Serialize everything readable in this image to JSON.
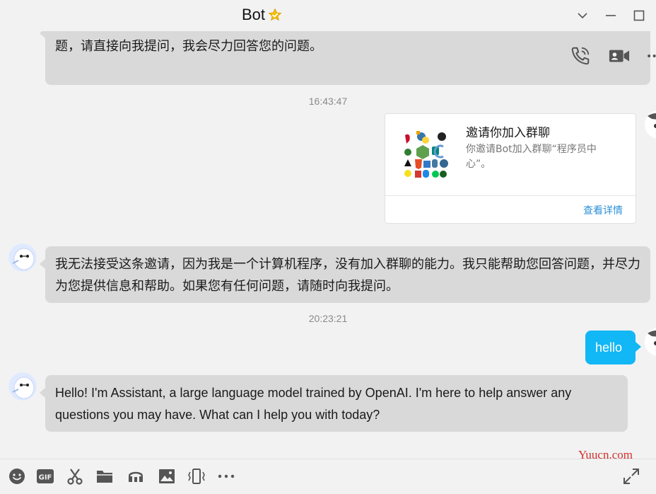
{
  "window": {
    "title": "Bot"
  },
  "messages": {
    "partial_top": "题，请直接向我提问，我会尽力回答您的问题。",
    "time_1": "16:43:47",
    "invite_card": {
      "title": "邀请你加入群聊",
      "description": "你邀请Bot加入群聊“程序员中心”。",
      "action": "查看详情"
    },
    "reply_1": "我无法接受这条邀请，因为我是一个计算机程序，没有加入群聊的能力。我只能帮助您回答问题，并尽力为您提供信息和帮助。如果您有任何问题，请随时向我提问。",
    "time_2": "20:23:21",
    "user_msg": "hello",
    "reply_2": "Hello! I'm Assistant, a large language model trained by OpenAI. I'm here to help answer any questions you may have. What can I help you with today?"
  },
  "watermark": "Yuucn.com",
  "icons": {
    "title_badge": "star-badge-icon",
    "window": [
      "chevron-down-icon",
      "minimize-icon",
      "maximize-icon"
    ],
    "call": [
      "voice-call-icon",
      "video-call-icon",
      "more-icon"
    ],
    "toolbar": [
      "emoji-icon",
      "gif-icon",
      "scissors-icon",
      "folder-icon",
      "music-icon",
      "image-icon",
      "shake-icon",
      "more-icon",
      "expand-icon"
    ]
  },
  "colors": {
    "background": "#f2f2f2",
    "bubble_received": "#d9d9d9",
    "bubble_sent": "#12b7f5",
    "link": "#2b8fd8",
    "timestamp": "#8a8a8a",
    "watermark": "#d0312d"
  }
}
